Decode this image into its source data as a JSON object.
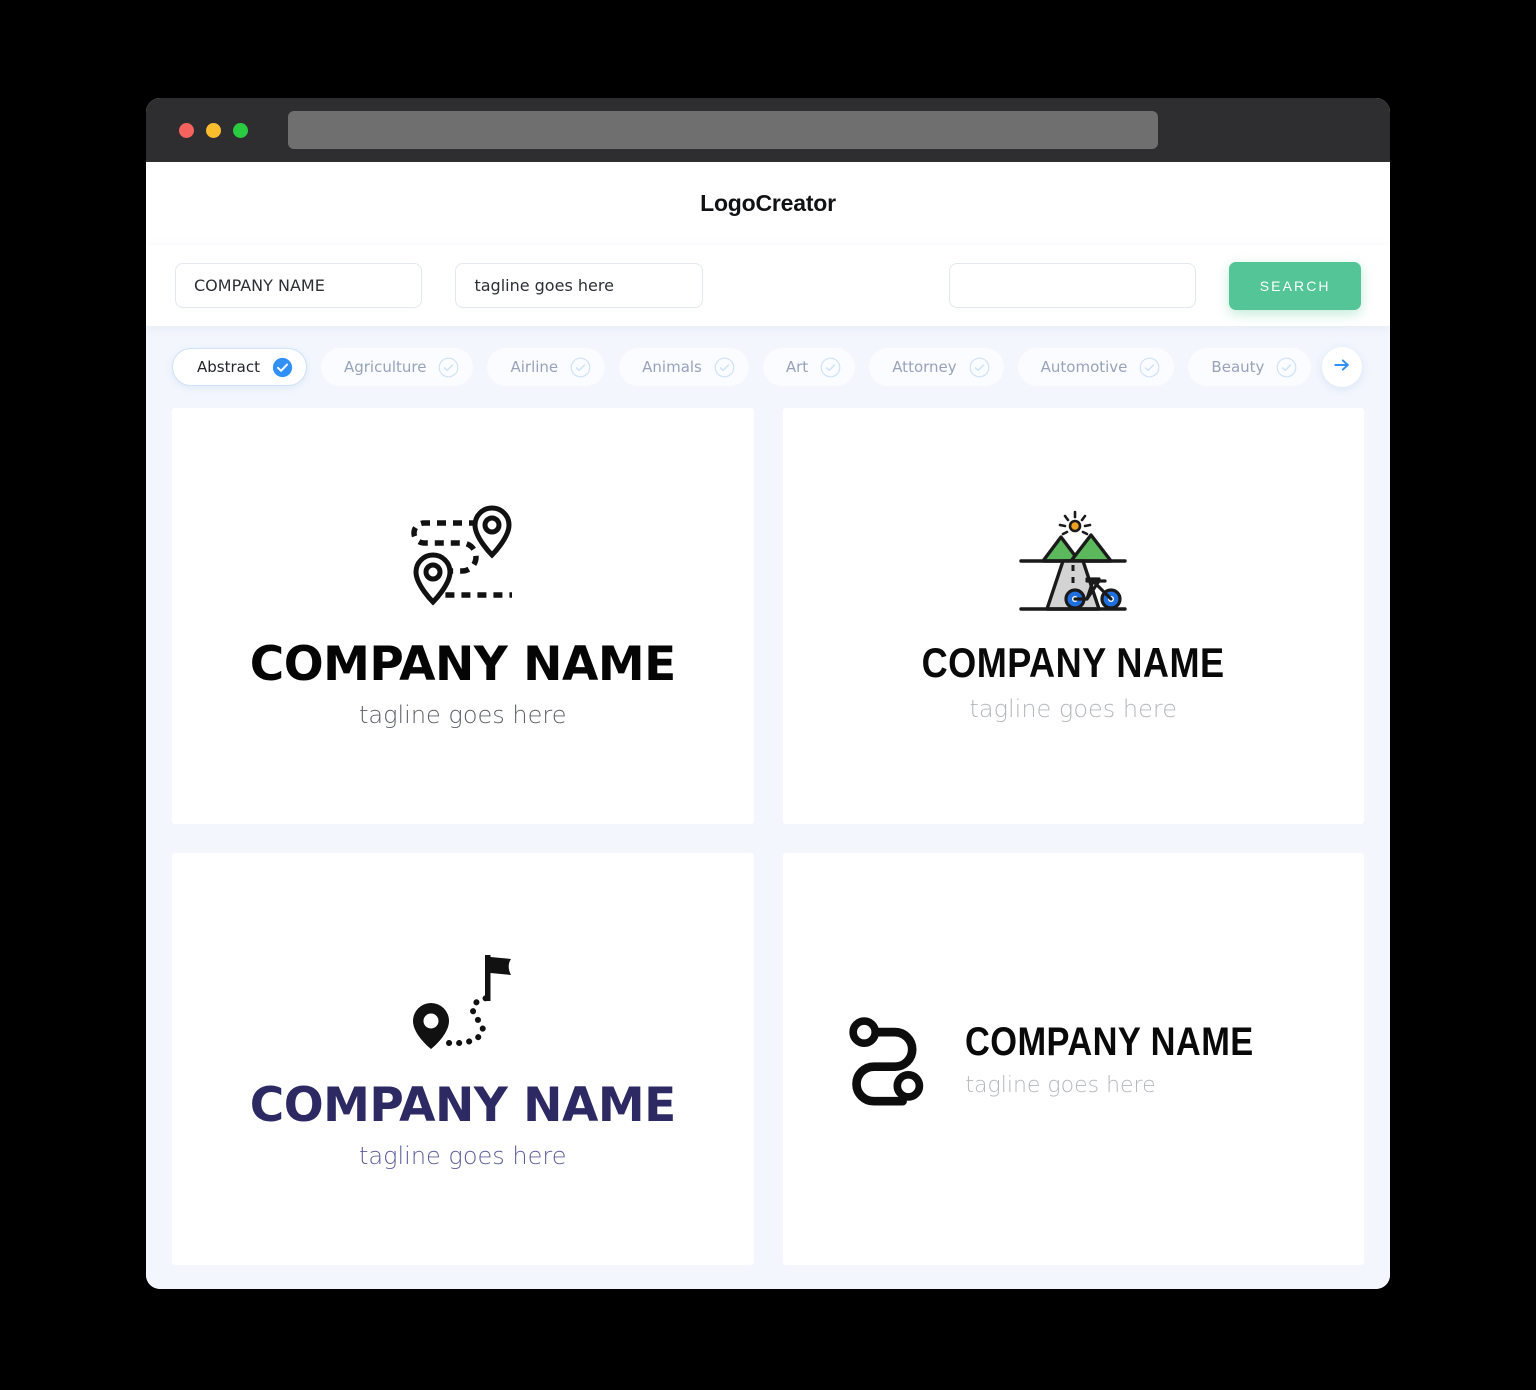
{
  "window": {
    "traffic_lights": [
      {
        "name": "close",
        "color": "#f6635e"
      },
      {
        "name": "minimize",
        "color": "#f9bd2e"
      },
      {
        "name": "maximize",
        "color": "#2acb41"
      }
    ],
    "url_value": ""
  },
  "header": {
    "brand": "LogoCreator"
  },
  "search": {
    "company_value": "COMPANY NAME",
    "company_placeholder": "COMPANY NAME",
    "tagline_value": "tagline goes here",
    "tagline_placeholder": "tagline goes here",
    "keyword_value": "",
    "keyword_placeholder": "",
    "search_label": "SEARCH",
    "search_button_color": "#53c596"
  },
  "categories": {
    "accent_color": "#2f90f5",
    "items": [
      {
        "label": "Abstract",
        "selected": true
      },
      {
        "label": "Agriculture",
        "selected": false
      },
      {
        "label": "Airline",
        "selected": false
      },
      {
        "label": "Animals",
        "selected": false
      },
      {
        "label": "Art",
        "selected": false
      },
      {
        "label": "Attorney",
        "selected": false
      },
      {
        "label": "Automotive",
        "selected": false
      },
      {
        "label": "Beauty",
        "selected": false
      }
    ],
    "next_arrow": "arrow-right-icon"
  },
  "results": {
    "cards": [
      {
        "icon": "route-two-pins-dashed-icon",
        "name": "COMPANY NAME",
        "tagline": "tagline goes here",
        "name_color": "#050505",
        "tagline_color": "#5c6068",
        "layout": "stacked"
      },
      {
        "icon": "mountain-road-bicycle-icon",
        "name": "COMPANY NAME",
        "tagline": "tagline goes here",
        "name_color": "#090909",
        "tagline_color": "#b4b7bc",
        "layout": "stacked",
        "icon_colors": {
          "mountain": "#5cb85c",
          "road": "#d3d3d3",
          "bicycle": "#1f6fe0",
          "sun": "#f0a020",
          "outline": "#1a1a1a"
        }
      },
      {
        "icon": "pin-path-flag-icon",
        "name": "COMPANY NAME",
        "tagline": "tagline goes here",
        "name_color": "#2d2a63",
        "tagline_color": "#5c5f9b",
        "layout": "stacked"
      },
      {
        "icon": "s-route-nodes-icon",
        "name": "COMPANY NAME",
        "tagline": "tagline goes here",
        "name_color": "#090909",
        "tagline_color": "#b4b7bc",
        "layout": "inline"
      }
    ]
  }
}
